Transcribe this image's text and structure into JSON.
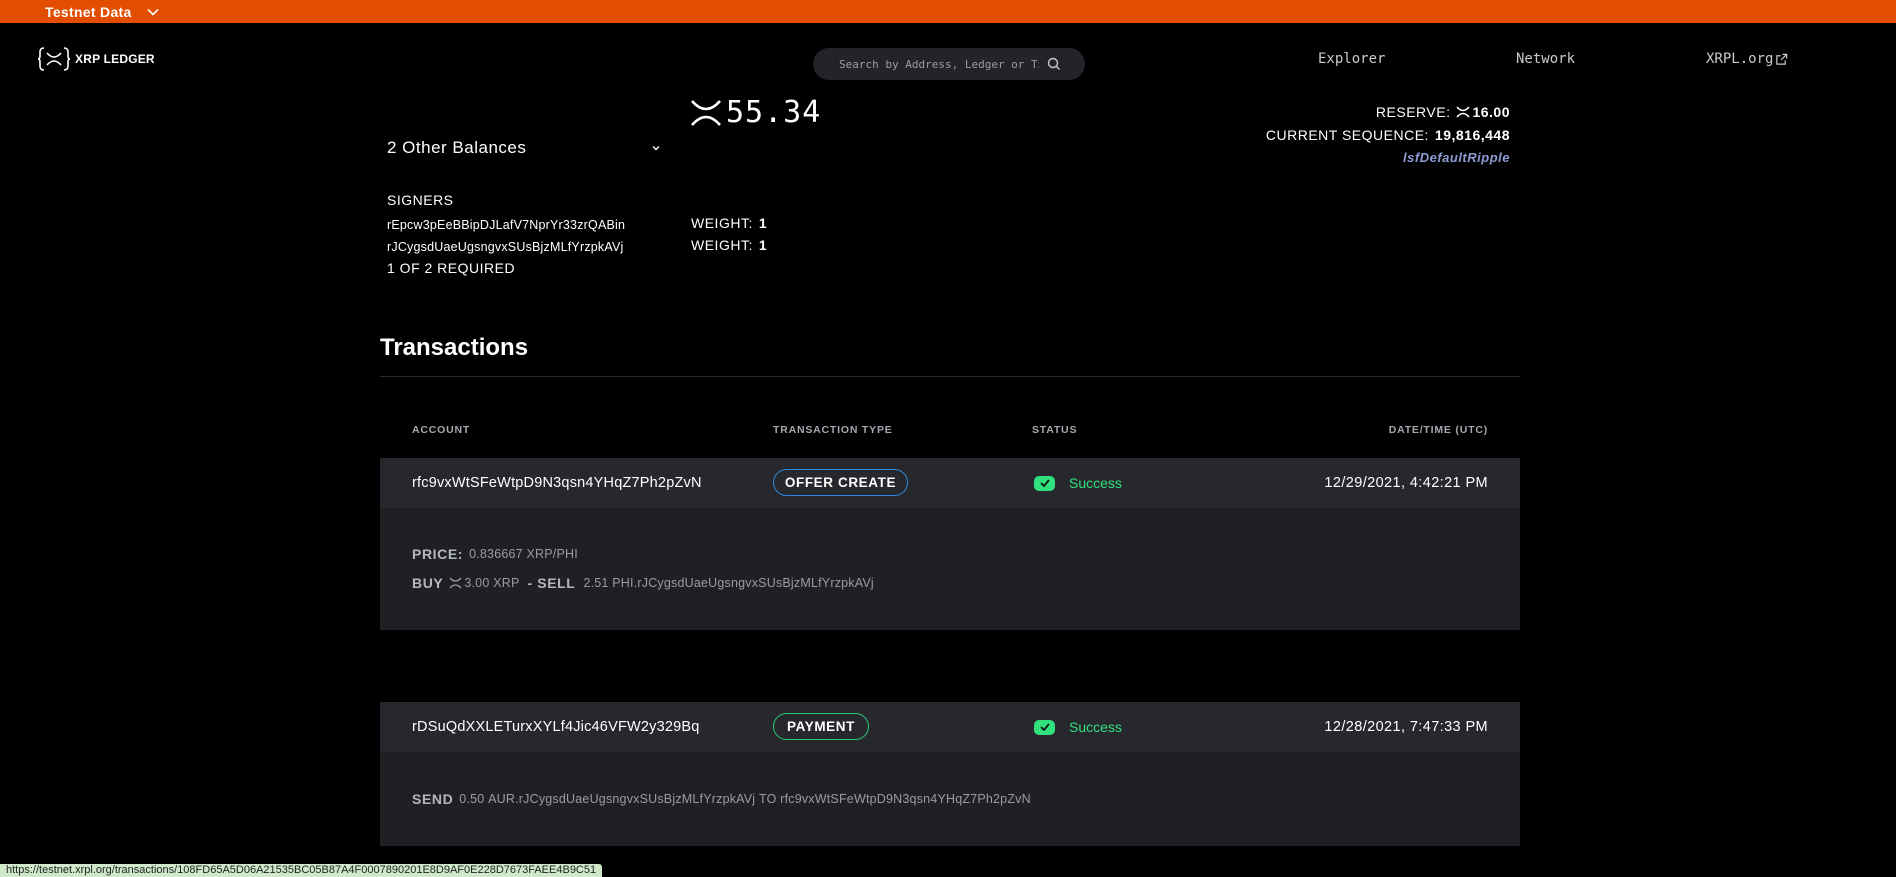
{
  "banner": {
    "label": "Testnet Data"
  },
  "header": {
    "logo_text": "XRP LEDGER",
    "search_placeholder": "Search by Address, Ledger or Txn",
    "nav": [
      "Explorer",
      "Network",
      "XRPL.org"
    ]
  },
  "account": {
    "balance": "55.34",
    "other_balances": "2 Other Balances",
    "reserve_label": "RESERVE:",
    "reserve_value": "16.00",
    "sequence_label": "CURRENT SEQUENCE:",
    "sequence_value": "19,816,448",
    "flag": "lsfDefaultRipple",
    "signers_title": "SIGNERS",
    "signers": [
      {
        "address": "rEpcw3pEeBBipDJLafV7NprYr33zrQABin",
        "weight_label": "WEIGHT:",
        "weight": "1"
      },
      {
        "address": "rJCygsdUaeUgsngvxSUsBjzMLfYrzpkAVj",
        "weight_label": "WEIGHT:",
        "weight": "1"
      }
    ],
    "quorum": "1 OF 2 REQUIRED"
  },
  "transactions": {
    "heading": "Transactions",
    "columns": [
      "ACCOUNT",
      "TRANSACTION TYPE",
      "STATUS",
      "DATE/TIME (UTC)"
    ],
    "rows": [
      {
        "account": "rfc9vxWtSFeWtpD9N3qsn4YHqZ7Ph2pZvN",
        "type": "OFFER CREATE",
        "status": "Success",
        "date": "12/29/2021, 4:42:21 PM",
        "price_label": "PRICE:",
        "price_value": "0.836667",
        "price_unit": "XRP/PHI",
        "buy_label": "BUY",
        "buy_value": "3.00",
        "buy_unit": "XRP",
        "sell_sep": "- SELL",
        "sell_value": "2.51",
        "sell_unit": "PHI.rJCygsdUaeUgsngvxSUsBjzMLfYrzpkAVj"
      },
      {
        "account": "rDSuQdXXLETurxXYLf4Jic46VFW2y329Bq",
        "type": "PAYMENT",
        "status": "Success",
        "date": "12/28/2021, 7:47:33 PM",
        "send_label": "SEND",
        "send_value": "0.50",
        "send_unit": "AUR.rJCygsdUaeUgsngvxSUsBjzMLfYrzpkAVj",
        "to_label": "TO",
        "to_address": "rfc9vxWtSFeWtpD9N3qsn4YHqZ7Ph2pZvN"
      }
    ]
  },
  "statusbar": {
    "url": "https://testnet.xrpl.org/transactions/108FD65A5D06A21535BC05B87A4F0007890201E8D9AF0E228D7673FAEE4B9C51"
  },
  "colors": {
    "banner": "#e24d00",
    "success": "#31e17e",
    "offer_badge": "#2a8ce2",
    "payment_badge": "#2bc877",
    "flag": "#8e9cd4"
  }
}
